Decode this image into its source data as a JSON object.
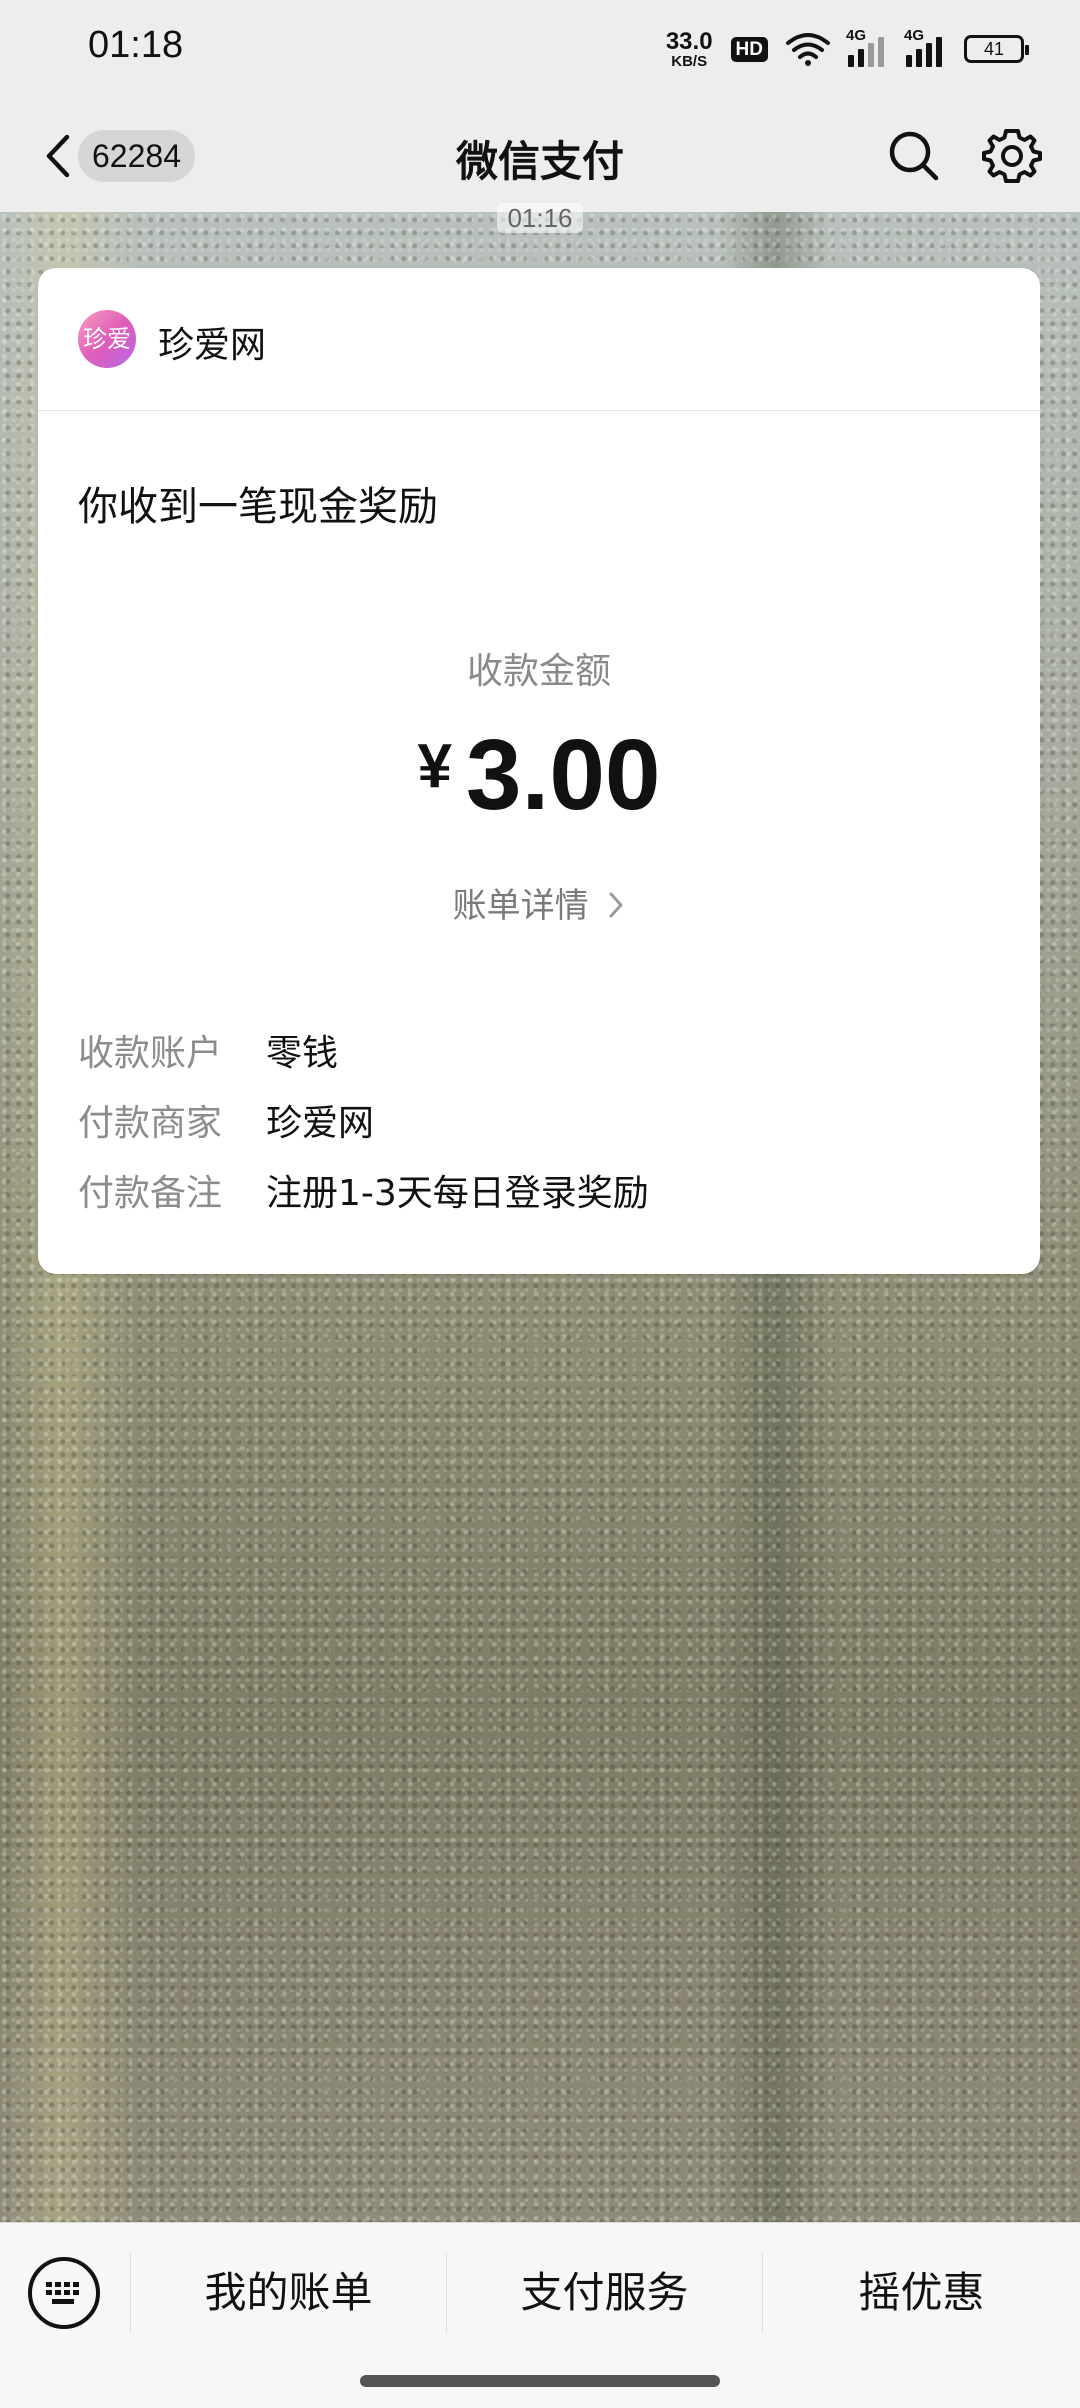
{
  "status_bar": {
    "time": "01:18",
    "net_speed_value": "33.0",
    "net_speed_unit": "KB/S",
    "hd_label": "HD",
    "signal1_label": "4G",
    "signal2_label": "4G",
    "battery_level": "41"
  },
  "nav": {
    "unread_count": "62284",
    "title": "微信支付"
  },
  "chat": {
    "message_time": "01:16"
  },
  "card": {
    "logo_text": "珍爱",
    "merchant": "珍爱网",
    "headline": "你收到一笔现金奖励",
    "amount_label": "收款金额",
    "currency": "¥",
    "amount": "3.00",
    "bill_detail": "账单详情",
    "info": [
      {
        "key": "收款账户",
        "value": "零钱"
      },
      {
        "key": "付款商家",
        "value": "珍爱网"
      },
      {
        "key": "付款备注",
        "value": "注册1-3天每日登录奖励"
      }
    ]
  },
  "bottom_menu": {
    "items": [
      "我的账单",
      "支付服务",
      "摇优惠"
    ]
  },
  "icons": {
    "back": "chevron-left-icon",
    "search": "search-icon",
    "settings": "gear-icon",
    "keyboard": "keyboard-icon",
    "bill_chevron": "chevron-right-icon"
  }
}
